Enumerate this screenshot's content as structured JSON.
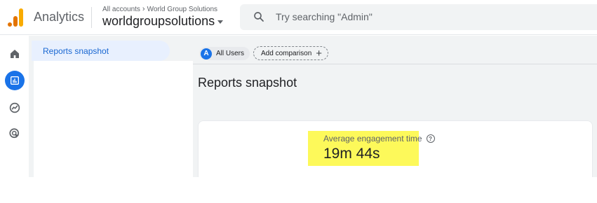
{
  "header": {
    "app_name": "Analytics",
    "breadcrumb": {
      "root": "All accounts",
      "account": "World Group Solutions"
    },
    "property": "worldgroupsolutions",
    "search_placeholder": "Try searching \"Admin\""
  },
  "rail": {
    "items": [
      {
        "name": "home",
        "icon": "home-icon",
        "active": false
      },
      {
        "name": "reports",
        "icon": "bar-chart-icon",
        "active": true
      },
      {
        "name": "explore",
        "icon": "explore-icon",
        "active": false
      },
      {
        "name": "advertising",
        "icon": "target-icon",
        "active": false
      }
    ]
  },
  "subnav": {
    "active_item": "Reports snapshot"
  },
  "comparison": {
    "segment_badge": "A",
    "segment_label": "All Users",
    "add_label": "Add comparison"
  },
  "main": {
    "title": "Reports snapshot",
    "metric": {
      "label": "Average engagement time",
      "value": "19m 44s"
    }
  },
  "colors": {
    "accent": "#1a73e8",
    "highlight": "#fdf95a",
    "logo_orange": "#e37400",
    "logo_yellow": "#f9ab00"
  }
}
